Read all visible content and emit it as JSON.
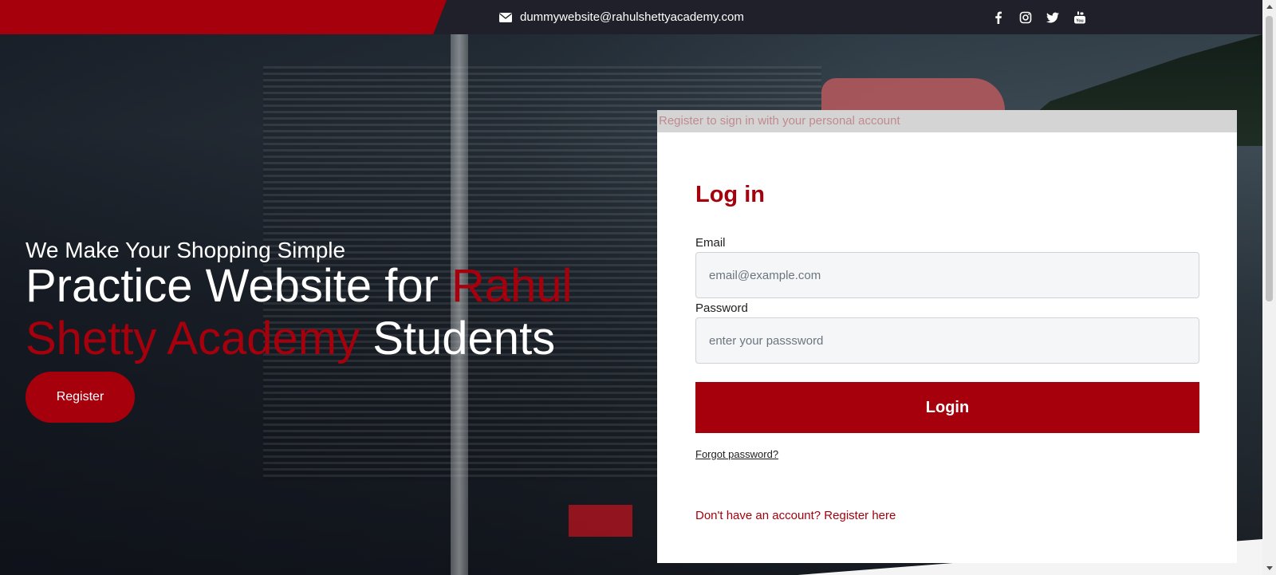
{
  "topbar": {
    "email": "dummywebsite@rahulshettyacademy.com",
    "email_icon": "envelope-icon",
    "socials": [
      {
        "name": "facebook-icon"
      },
      {
        "name": "instagram-icon"
      },
      {
        "name": "twitter-icon"
      },
      {
        "name": "youtube-icon"
      }
    ]
  },
  "hero": {
    "tagline": "We Make Your Shopping Simple",
    "headline_part1": "Practice Website for ",
    "headline_accent": "Rahul Shetty Academy",
    "headline_part2": " Students",
    "register_label": "Register"
  },
  "login": {
    "header_text": "Register to sign in with your personal account",
    "title": "Log in",
    "email_label": "Email",
    "email_placeholder": "email@example.com",
    "email_value": "",
    "password_label": "Password",
    "password_placeholder": "enter your passsword",
    "password_value": "",
    "login_label": "Login",
    "forgot_label": "Forgot password?",
    "register_link_label": "Don't have an account? Register here"
  },
  "colors": {
    "brand_red": "#a6000d",
    "topbar_dark": "#1f2029"
  }
}
